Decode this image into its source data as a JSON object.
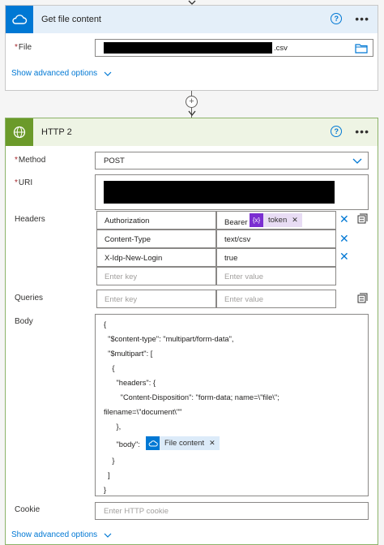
{
  "card1": {
    "title": "Get file content",
    "file_label": "File",
    "file_suffix": ".csv",
    "advanced": "Show advanced options",
    "color": "#0078d4"
  },
  "card2": {
    "title": "HTTP 2",
    "method_label": "Method",
    "method_value": "POST",
    "uri_label": "URI",
    "headers_label": "Headers",
    "headers": [
      {
        "key": "Authorization",
        "value": "Bearer"
      },
      {
        "key": "Content-Type",
        "value": "text/csv"
      },
      {
        "key": "X-Idp-New-Login",
        "value": "true"
      }
    ],
    "token_label": "token",
    "token_icon": "{x}",
    "key_placeholder": "Enter key",
    "value_placeholder": "Enter value",
    "queries_label": "Queries",
    "body_label": "Body",
    "body_lines": [
      "{",
      "  \"$content-type\": \"multipart/form-data\",",
      "  \"$multipart\": [",
      "    {",
      "      \"headers\": {",
      "        \"Content-Disposition\": \"form-data; name=\\\"file\\\";",
      "filename=\\\"document\\\"\"",
      "      },",
      "      \"body\":",
      "    }",
      "  ]",
      "}"
    ],
    "file_content_label": "File content",
    "cookie_label": "Cookie",
    "cookie_placeholder": "Enter HTTP cookie",
    "advanced": "Show advanced options",
    "color": "#6b9a2a"
  }
}
